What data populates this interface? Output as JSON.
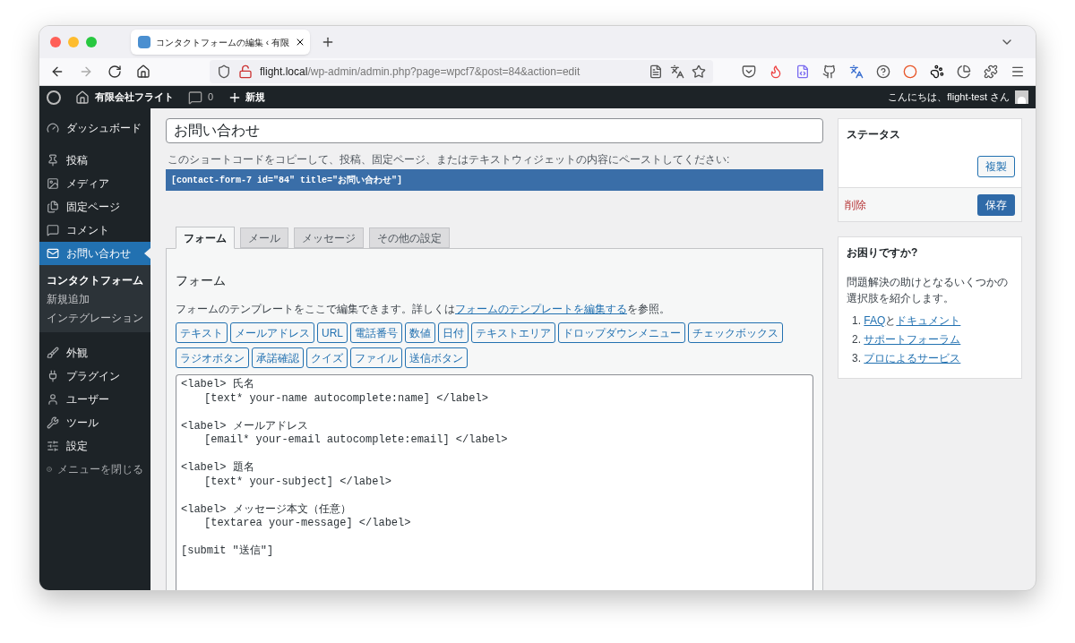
{
  "browser": {
    "tab_title": "コンタクトフォームの編集 ‹ 有限",
    "url": {
      "host": "flight.local",
      "path": "/wp-admin/admin.php?page=wpcf7&post=84&action=edit"
    }
  },
  "admin_bar": {
    "site_name": "有限会社フライト",
    "comments": "0",
    "new": "新規",
    "greeting": "こんにちは、flight-test さん"
  },
  "sidebar": {
    "items": [
      {
        "label": "ダッシュボード",
        "selected": false
      },
      {
        "label": "投稿",
        "selected": false
      },
      {
        "label": "メディア",
        "selected": false
      },
      {
        "label": "固定ページ",
        "selected": false
      },
      {
        "label": "コメント",
        "selected": false
      },
      {
        "label": "お問い合わせ",
        "selected": true,
        "children": [
          {
            "label": "コンタクトフォーム",
            "selected": true
          },
          {
            "label": "新規追加",
            "selected": false
          },
          {
            "label": "インテグレーション",
            "selected": false
          }
        ]
      },
      {
        "label": "外観",
        "selected": false
      },
      {
        "label": "プラグイン",
        "selected": false
      },
      {
        "label": "ユーザー",
        "selected": false
      },
      {
        "label": "ツール",
        "selected": false
      },
      {
        "label": "設定",
        "selected": false
      }
    ],
    "collapse": "メニューを閉じる"
  },
  "editor": {
    "title": "お問い合わせ",
    "shortcode_hint": "このショートコードをコピーして、投稿、固定ページ、またはテキストウィジェットの内容にペーストしてください:",
    "shortcode": "[contact-form-7 id=\"84\" title=\"お問い合わせ\"]",
    "tabs": [
      {
        "label": "フォーム",
        "selected": true
      },
      {
        "label": "メール",
        "selected": false
      },
      {
        "label": "メッセージ",
        "selected": false
      },
      {
        "label": "その他の設定",
        "selected": false
      }
    ],
    "panel_heading": "フォーム",
    "description": {
      "before": "フォームのテンプレートをここで編集できます。詳しくは",
      "link": "フォームのテンプレートを編集する",
      "after": "を参照。"
    },
    "tag_buttons": [
      "テキスト",
      "メールアドレス",
      "URL",
      "電話番号",
      "数値",
      "日付",
      "テキストエリア",
      "ドロップダウンメニュー",
      "チェックボックス",
      "ラジオボタン",
      "承諾確認",
      "クイズ",
      "ファイル",
      "送信ボタン"
    ],
    "template": [
      {
        "lines": [
          "<label> 氏名",
          "[text* your-name autocomplete:name] </label>"
        ]
      },
      {
        "lines": [
          "<label> メールアドレス",
          "[email* your-email autocomplete:email] </label>"
        ]
      },
      {
        "lines": [
          "<label> 題名",
          "[text* your-subject] </label>"
        ]
      },
      {
        "lines": [
          "<label> メッセージ本文（任意）",
          "[textarea your-message] </label>"
        ]
      },
      {
        "lines": [
          "[submit \"送信\"]"
        ]
      }
    ]
  },
  "status_box": {
    "title": "ステータス",
    "duplicate": "複製",
    "delete": "削除",
    "save": "保存"
  },
  "help_box": {
    "title": "お困りですか?",
    "text": "問題解決の助けとなるいくつかの選択肢を紹介します。",
    "items": [
      {
        "number": "1.",
        "parts": [
          {
            "text": "FAQ",
            "link": true
          },
          {
            "text": "と",
            "link": false
          },
          {
            "text": "ドキュメント",
            "link": true
          }
        ]
      },
      {
        "number": "2.",
        "parts": [
          {
            "text": "サポートフォーラム",
            "link": true
          }
        ]
      },
      {
        "number": "3.",
        "parts": [
          {
            "text": "プロによるサービス",
            "link": true
          }
        ]
      }
    ]
  }
}
